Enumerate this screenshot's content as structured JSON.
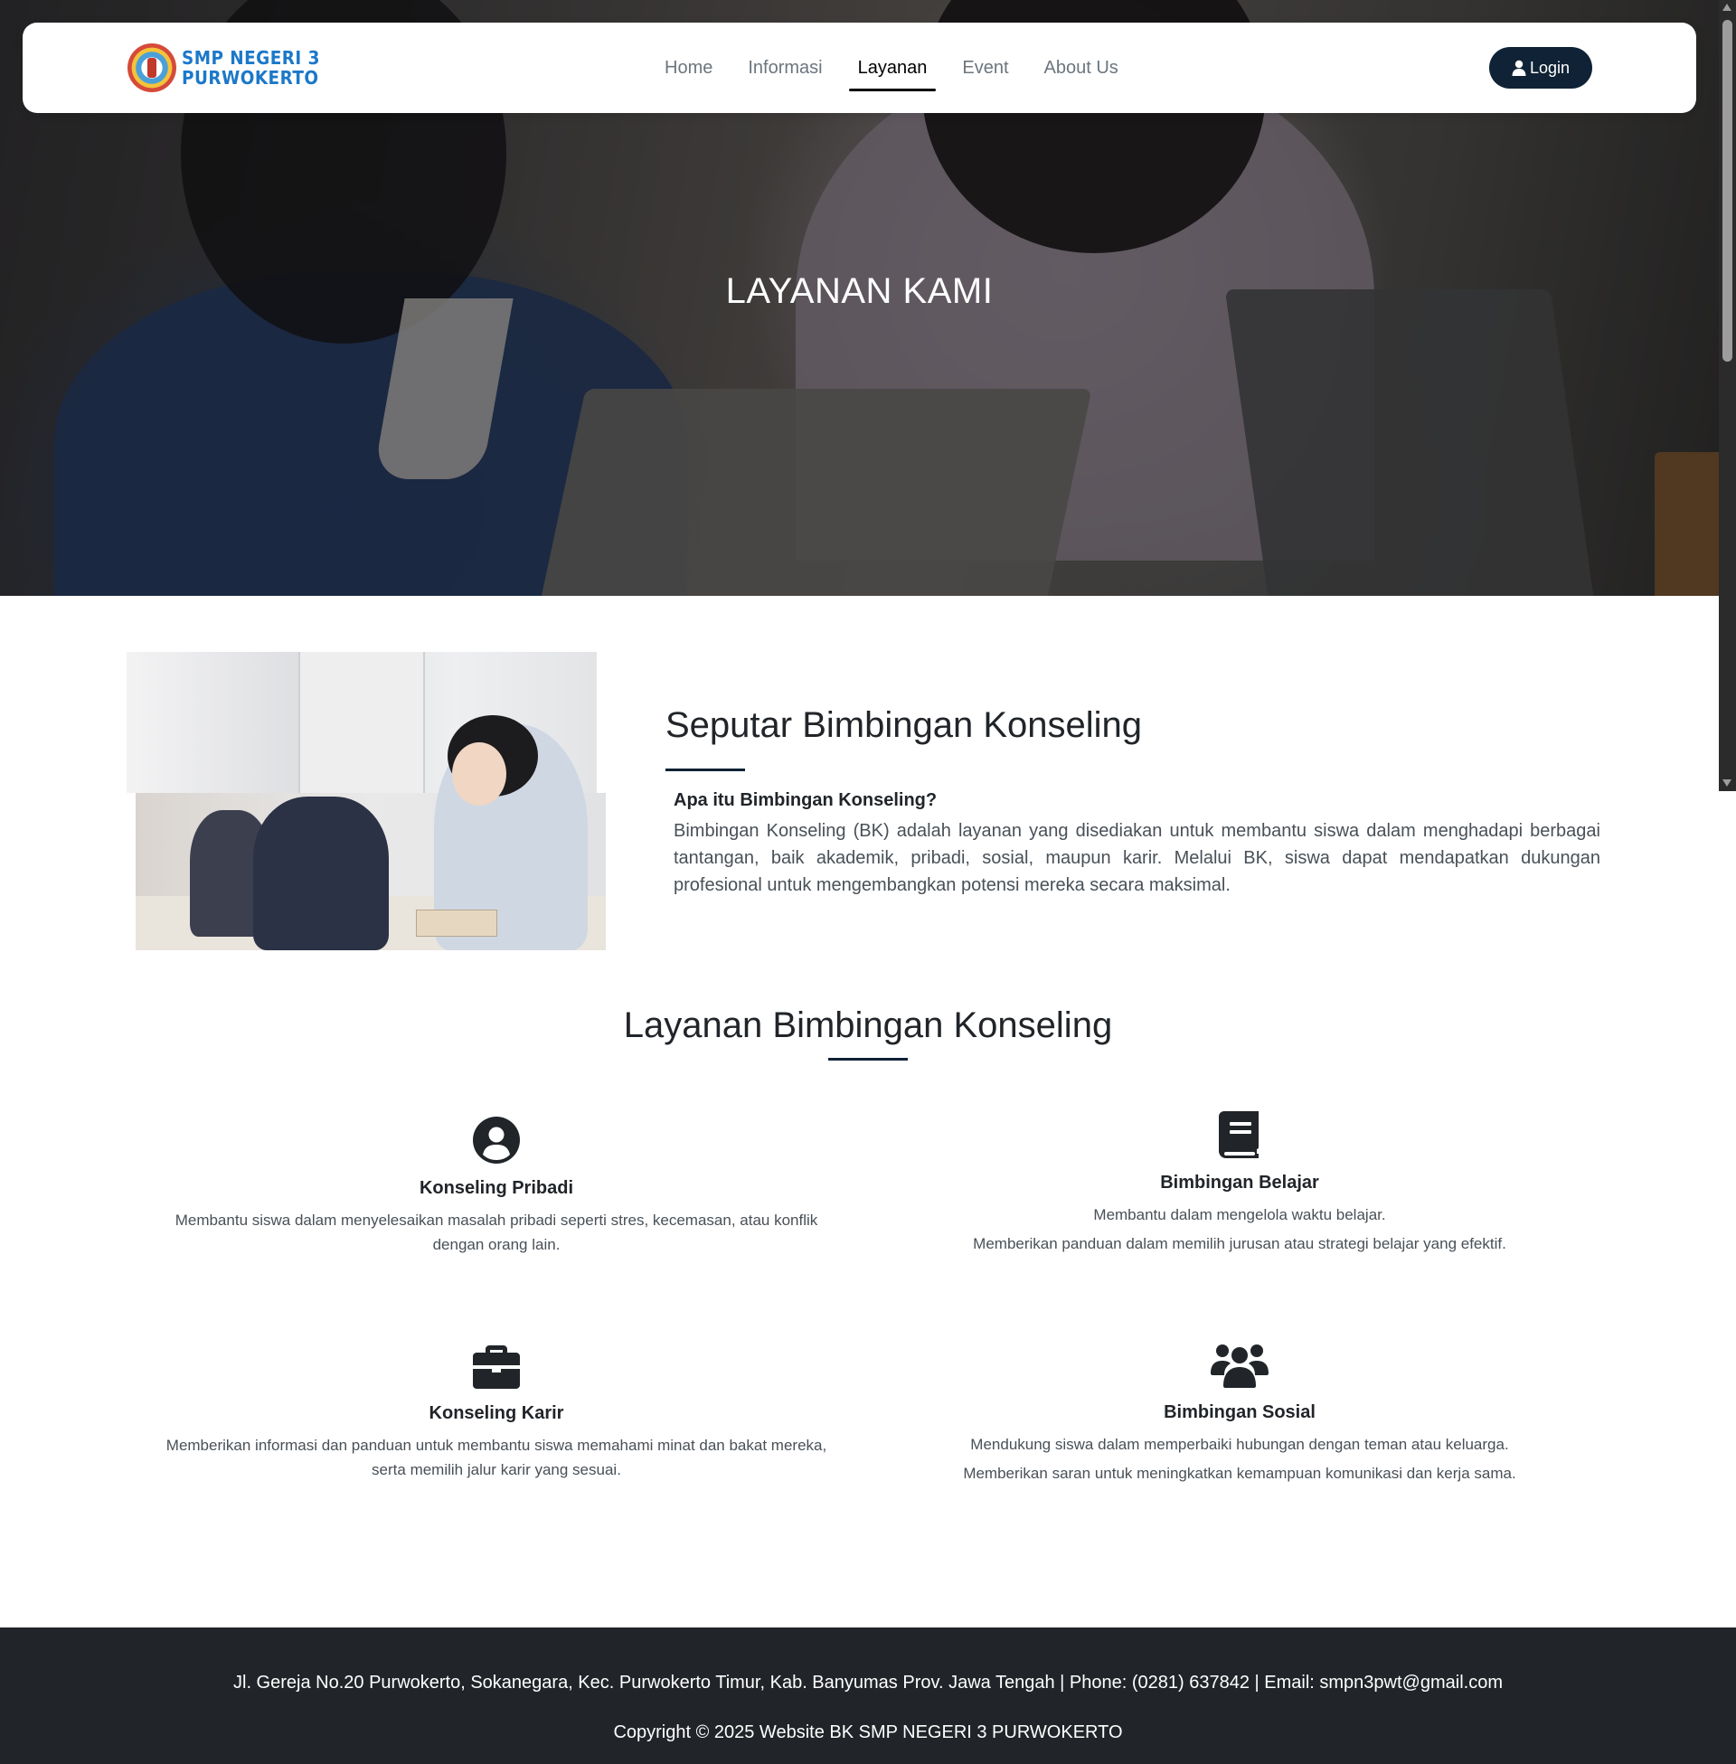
{
  "brand": {
    "line1": "SMP NEGERI 3",
    "line2": "PURWOKERTO"
  },
  "nav": {
    "items": [
      {
        "label": "Home",
        "active": false
      },
      {
        "label": "Informasi",
        "active": false
      },
      {
        "label": "Layanan",
        "active": true
      },
      {
        "label": "Event",
        "active": false
      },
      {
        "label": "About Us",
        "active": false
      }
    ],
    "login_label": "Login"
  },
  "hero": {
    "title": "LAYANAN KAMI"
  },
  "about": {
    "title": "Seputar Bimbingan Konseling",
    "question": "Apa itu Bimbingan Konseling?",
    "paragraph": "Bimbingan Konseling (BK) adalah layanan yang disediakan untuk membantu siswa dalam menghadapi berbagai tantangan, baik akademik, pribadi, sosial, maupun karir. Melalui BK, siswa dapat mendapatkan dukungan profesional untuk mengembangkan potensi mereka secara maksimal."
  },
  "services": {
    "title": "Layanan Bimbingan Konseling",
    "items": [
      {
        "icon": "user-circle-icon",
        "title": "Konseling Pribadi",
        "desc_lines": [
          "Membantu siswa dalam menyelesaikan masalah pribadi seperti stres, kecemasan, atau konflik",
          "dengan orang lain."
        ]
      },
      {
        "icon": "book-icon",
        "title": "Bimbingan Belajar",
        "desc_lines": [
          "Membantu dalam mengelola waktu belajar.",
          "Memberikan panduan dalam memilih jurusan atau strategi belajar yang efektif."
        ]
      },
      {
        "icon": "briefcase-icon",
        "title": "Konseling Karir",
        "desc_lines": [
          "Memberikan informasi dan panduan untuk membantu siswa memahami minat dan bakat mereka,",
          "serta memilih jalur karir yang sesuai."
        ]
      },
      {
        "icon": "users-icon",
        "title": "Bimbingan Sosial",
        "desc_lines": [
          "Mendukung siswa dalam memperbaiki hubungan dengan teman atau keluarga.",
          "Memberikan saran untuk meningkatkan kemampuan komunikasi dan kerja sama."
        ]
      }
    ]
  },
  "footer": {
    "address": "Jl. Gereja No.20 Purwokerto, Sokanegara, Kec. Purwokerto Timur, Kab. Banyumas Prov. Jawa Tengah | Phone: (0281) 637842 | Email: smpn3pwt@gmail.com",
    "copyright": "Copyright © 2025 Website BK SMP NEGERI 3 PURWOKERTO"
  },
  "colors": {
    "primary_dark": "#0f2236",
    "footer_bg": "#212529",
    "text_dark": "#212529",
    "text_muted": "#495057",
    "nav_muted": "#6c757d"
  }
}
